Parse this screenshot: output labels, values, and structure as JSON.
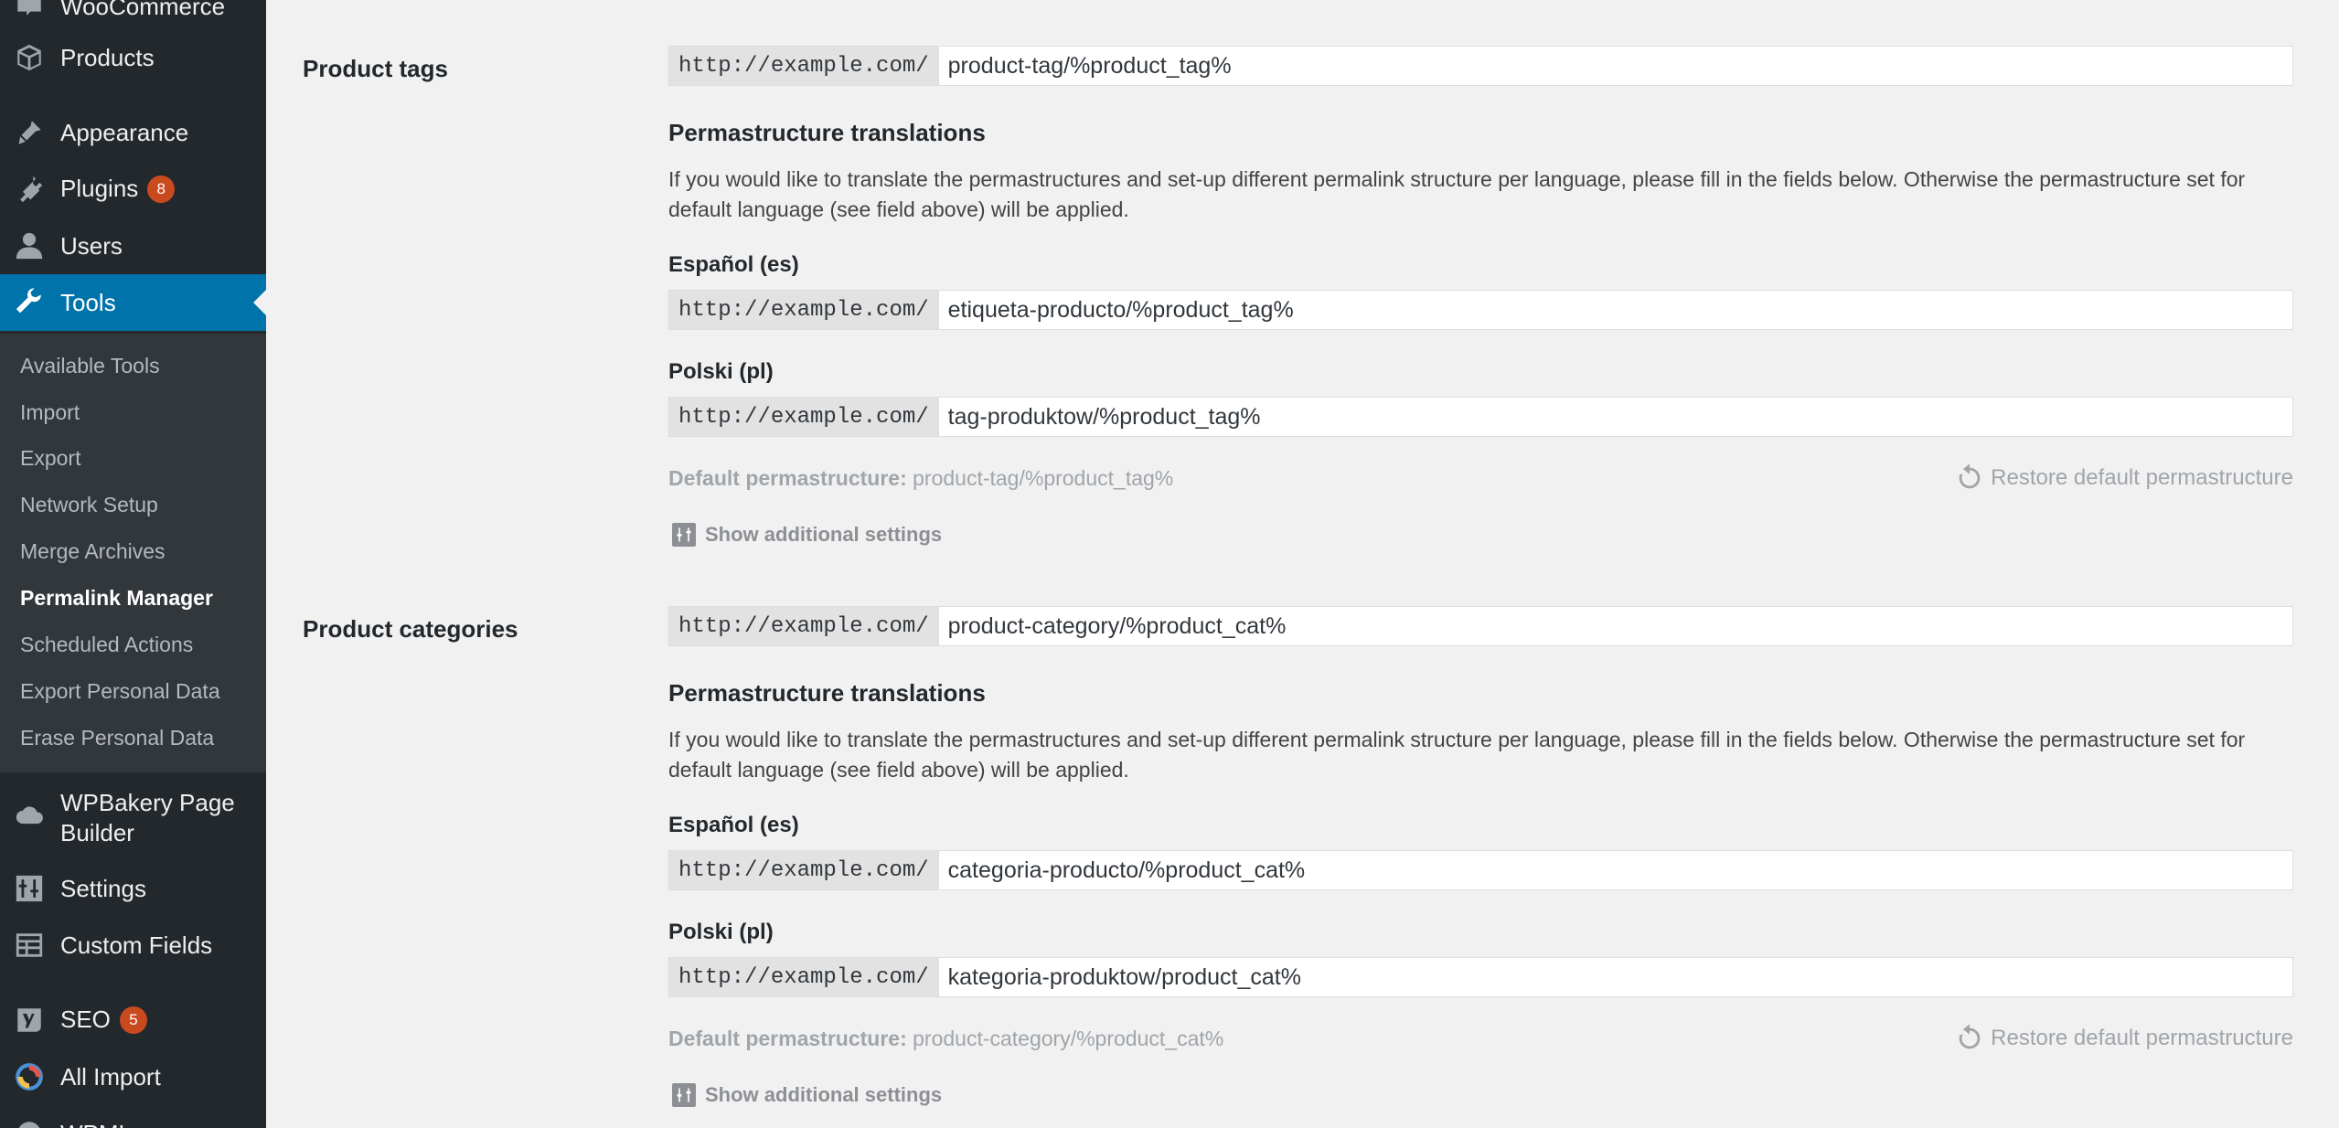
{
  "sidebar": {
    "top_items": [
      {
        "label": "WooCommerce",
        "icon": "woocommerce-icon"
      },
      {
        "label": "Products",
        "icon": "products-icon"
      },
      {
        "label": "Appearance",
        "icon": "appearance-icon"
      },
      {
        "label": "Plugins",
        "icon": "plugins-icon",
        "badge": "8"
      },
      {
        "label": "Users",
        "icon": "users-icon"
      },
      {
        "label": "Tools",
        "icon": "tools-icon",
        "active": true
      }
    ],
    "submenu": [
      "Available Tools",
      "Import",
      "Export",
      "Network Setup",
      "Merge Archives",
      "Permalink Manager",
      "Scheduled Actions",
      "Export Personal Data",
      "Erase Personal Data"
    ],
    "current_submenu": "Permalink Manager",
    "bottom_items": [
      {
        "label": "WPBakery Page Builder",
        "icon": "wpbakery-icon"
      },
      {
        "label": "Settings",
        "icon": "settings-icon"
      },
      {
        "label": "Custom Fields",
        "icon": "custom-fields-icon"
      },
      {
        "label": "SEO",
        "icon": "seo-icon",
        "badge": "5"
      },
      {
        "label": "All Import",
        "icon": "all-import-icon"
      },
      {
        "label": "WPML",
        "icon": "wpml-icon"
      }
    ],
    "wpbakery_line1": "WPBakery Page",
    "wpbakery_line2": "Builder"
  },
  "common": {
    "url_prefix": "http://example.com/",
    "translations_heading": "Permastructure translations",
    "translations_desc": "If you would like to translate the permastructures and set-up different permalink structure per language, please fill in the fields below. Otherwise the permastructure set for default language (see field above) will be applied.",
    "lang_es": "Español (es)",
    "lang_pl": "Polski (pl)",
    "default_label": "Default permastructure:",
    "restore_label": "Restore default permastructure",
    "show_settings_label": "Show additional settings"
  },
  "sections": {
    "tags": {
      "label": "Product tags",
      "value": "product-tag/%product_tag%",
      "es_value": "etiqueta-producto/%product_tag%",
      "pl_value": "tag-produktow/%product_tag%",
      "default_value": "product-tag/%product_tag%"
    },
    "categories": {
      "label": "Product categories",
      "value": "product-category/%product_cat%",
      "es_value": "categoria-producto/%product_cat%",
      "pl_value": "kategoria-produktow/product_cat%",
      "default_value": "product-category/%product_cat%"
    }
  },
  "colors": {
    "sidebar_bg": "#23282d",
    "submenu_bg": "#32373c",
    "active_bg": "#0073aa",
    "badge_bg": "#ca4a1f",
    "page_bg": "#f1f1f1"
  }
}
